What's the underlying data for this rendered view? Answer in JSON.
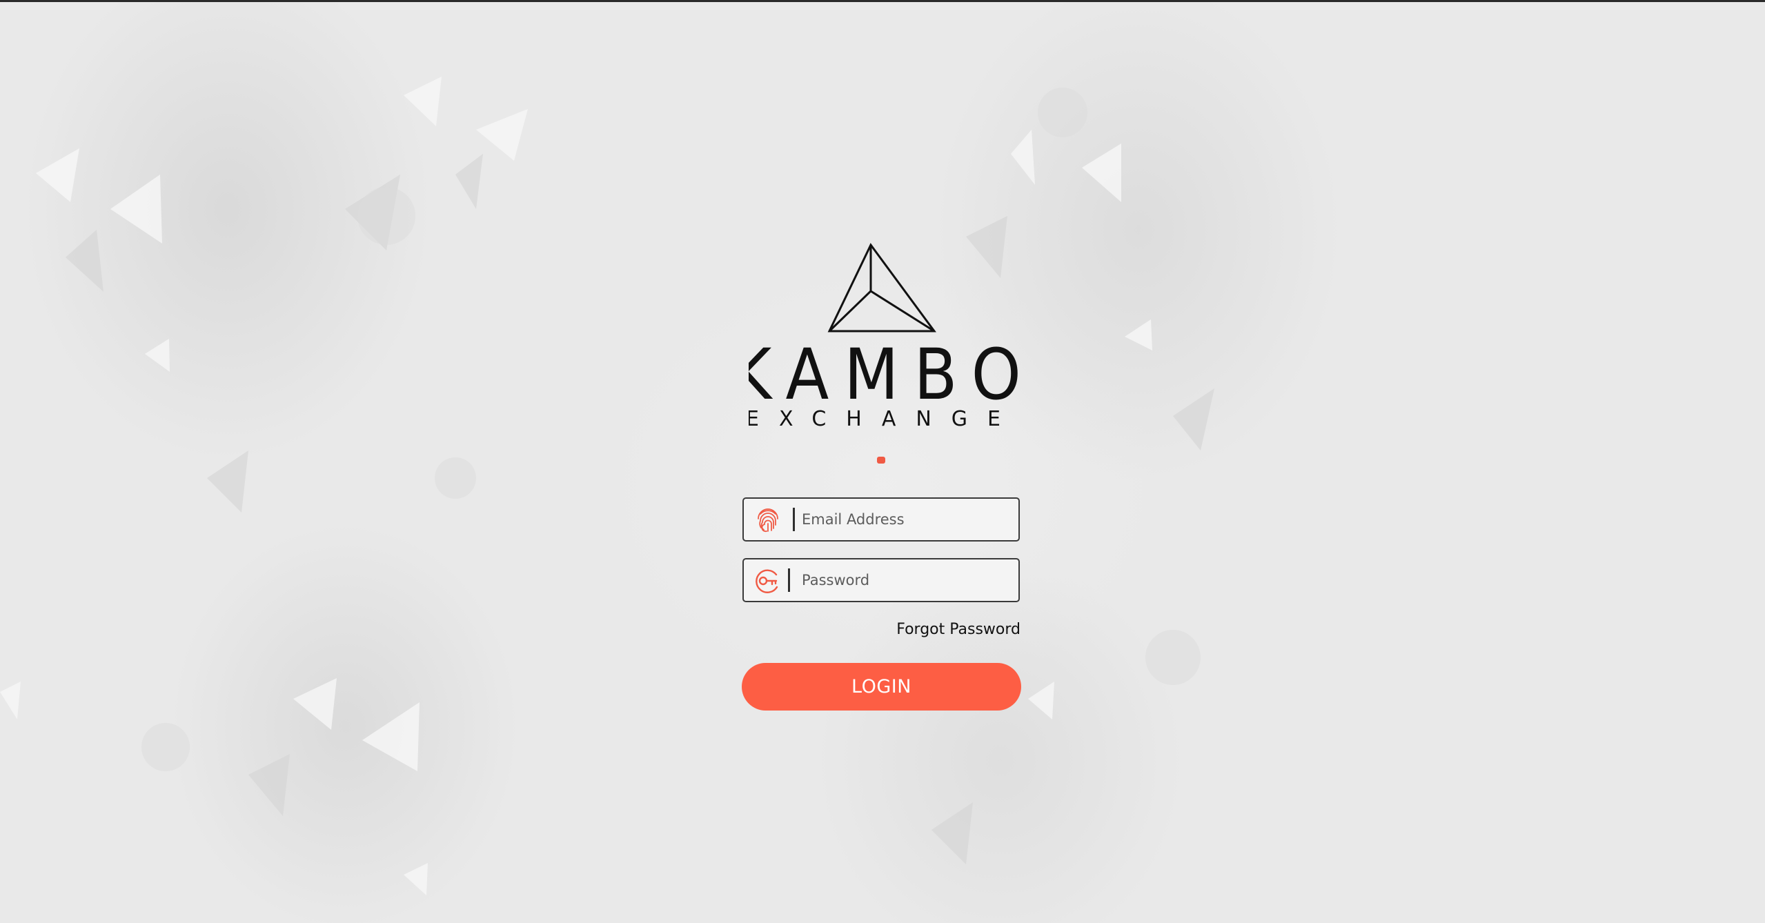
{
  "brand": {
    "name": "KAMBO",
    "subtitle": "EXCHANGE"
  },
  "colors": {
    "accent": "#fd5e44",
    "background": "#e9e9e9",
    "field_border": "#3a3a3a"
  },
  "form": {
    "email": {
      "placeholder": "Email Address",
      "icon": "fingerprint-icon",
      "value": ""
    },
    "password": {
      "placeholder": "Password",
      "icon": "key-icon",
      "value": ""
    },
    "forgot_label": "Forgot Password",
    "login_label": "LOGIN"
  }
}
